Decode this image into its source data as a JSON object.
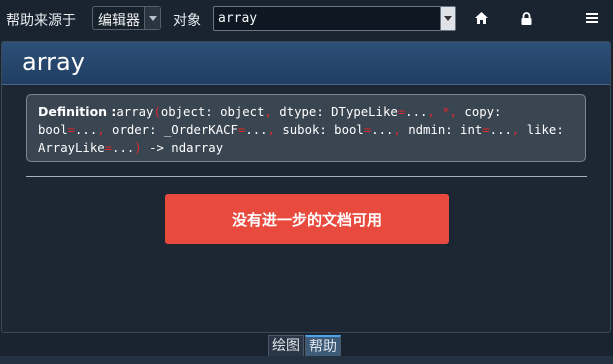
{
  "toolbar": {
    "help_source_label": "帮助来源于",
    "source_select": "编辑器",
    "object_label": "对象",
    "object_input_value": "array"
  },
  "icons": {
    "home": "home-icon",
    "lock": "lock-icon",
    "menu": "hamburger-menu-icon"
  },
  "panel": {
    "title": "array",
    "definition_label": "Definition :",
    "signature": {
      "p1": "array",
      "p2": "(",
      "p3": "object: object",
      "p4": ",",
      "p5": " dtype: DTypeLike",
      "p6": "=",
      "p7": "...",
      "p8": ",",
      "p9": " ",
      "p10": "*",
      "p11": ",",
      "p12": " copy: bool",
      "p13": "=",
      "p14": "...",
      "p15": ",",
      "p16": " order: _OrderKACF",
      "p17": "=",
      "p18": "...",
      "p19": ",",
      "p20": " subok: bool",
      "p21": "=",
      "p22": "...",
      "p23": ",",
      "p24": " ndmin: int",
      "p25": "=",
      "p26": "...",
      "p27": ",",
      "p28": " like: ArrayLike",
      "p29": "=",
      "p30": "...",
      "p31": ")",
      "p32": " -> ndarray"
    },
    "no_doc_button": "没有进一步的文档可用"
  },
  "tabs": [
    {
      "label": "绘图",
      "active": false
    },
    {
      "label": "帮助",
      "active": true
    }
  ],
  "colors": {
    "accent_red": "#e84a3d",
    "header_blue": "#2d5079",
    "tab_active_border": "#4fa3e8"
  }
}
